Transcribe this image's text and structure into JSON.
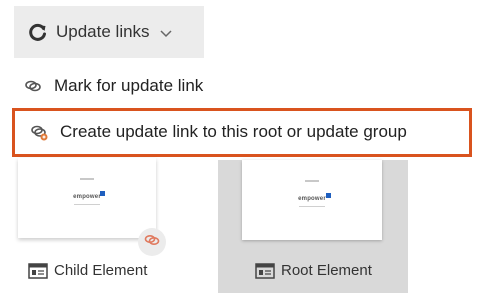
{
  "toolbar": {
    "update_links_label": "Update links",
    "refresh_icon": "refresh-icon",
    "chevron_icon": "chevron-down-icon"
  },
  "menu": {
    "items": [
      {
        "label": "Mark for update link",
        "icon": "link-icon",
        "highlighted": false
      },
      {
        "label": "Create update link to this root or update group",
        "icon": "link-add-icon",
        "highlighted": true
      }
    ],
    "highlight_color": "#d9531e"
  },
  "elements": {
    "child": {
      "label": "Child Element",
      "thumbnail_logo": "empower",
      "badge_icon": "link-icon",
      "badge_color": "#e07a5f"
    },
    "root": {
      "label": "Root Element",
      "thumbnail_logo": "empower",
      "selected": true
    }
  },
  "colors": {
    "button_bg": "#ececec",
    "selected_bg": "#d9d9d9",
    "logo_accent": "#1f5fbf"
  }
}
